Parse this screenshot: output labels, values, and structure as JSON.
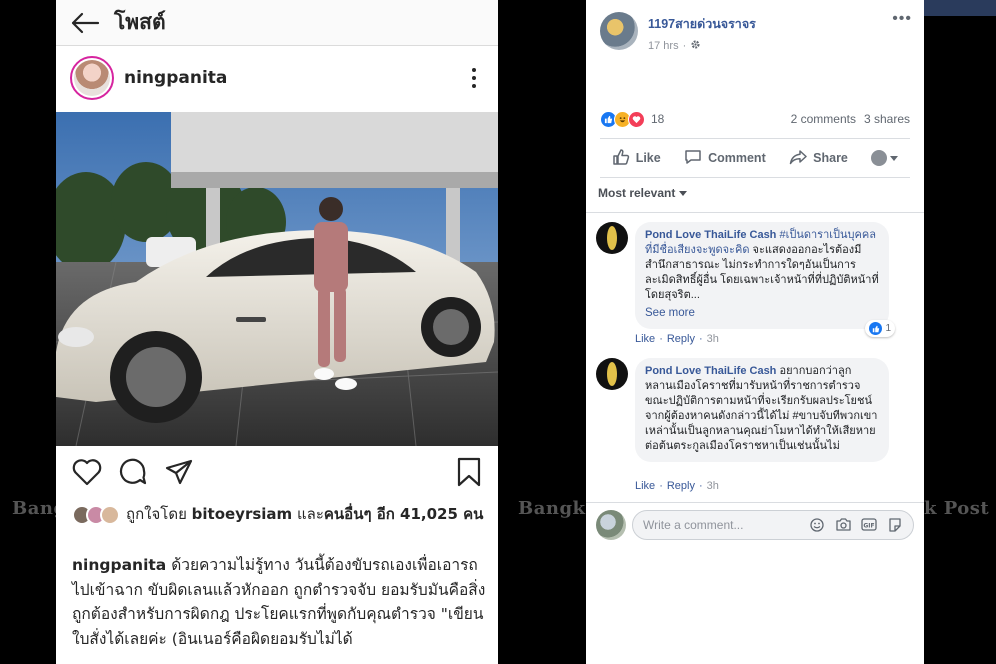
{
  "watermarks": {
    "left": "Bangk",
    "middle": "Bangko",
    "right": "k Post"
  },
  "instagram": {
    "header_title": "โพสต์",
    "username": "ningpanita",
    "liked_by_prefix": "ถูกใจโดย",
    "liked_by_user": "bitoeyrsiam",
    "liked_by_and": "และ",
    "liked_by_others": "คนอื่นๆ อีก 41,025 คน",
    "caption_user": "ningpanita",
    "caption_text": "ด้วยความไม่รู้ทาง วันนี้ต้องขับรถเองเพื่อเอารถไปเข้าฉาก ขับผิดเลนแล้วหักออก ถูกตำรวจจับ ยอมรับมันคือสิ่งถูกต้องสำหรับการผิดกฎ ประโยคแรกที่พูดกับคุณตำรวจ \"เขียนใบสั่งได้เลยค่ะ (อินเนอร์คือผิดยอมรับไม่ได้"
  },
  "facebook": {
    "page_name": "1197สายด่วนจราจร",
    "post_time": "17 hrs",
    "reaction_count": "18",
    "comments_count": "2 comments",
    "shares_count": "3 shares",
    "actions": {
      "like": "Like",
      "comment": "Comment",
      "share": "Share"
    },
    "sort_label": "Most relevant",
    "comments": [
      {
        "author": "Pond Love ThaiLife Cash",
        "tag": "#เป็นดาราเป็นบุคคลที่มีชื่อเสียงจะพูดจะคิด",
        "text": "จะแสดงออกอะไรต้องมีสำนึกสาธารณะ ไม่กระทำการใดๆอันเป็นการละเมิดสิทธิ์ผู้อื่น โดยเฉพาะเจ้าหน้าที่ที่ปฏิบัติหน้าที่โดยสุจริต...",
        "see_more": "See more",
        "reactions": "1",
        "like": "Like",
        "reply": "Reply",
        "time": "3h"
      },
      {
        "author": "Pond Love ThaiLife Cash",
        "text": "อยากบอกว่าลูกหลานเมืองโคราชที่มารับหน้าที่ราชการตำรวจ ขณะปฏิบัติการตามหน้าที่จะเรียกรับผลประโยชน์จากผู้ต้องหาคนดังกล่าวนี้ได้ไม่ #ขาบจับทีพวกเขาเหล่านั้นเป็นลูกหลานคุณย่าโมหาได้ทำให้เสียหายต่อต้นตระกูลเมืองโคราชหาเป็นเช่นนั้นไม่",
        "like": "Like",
        "reply": "Reply",
        "time": "3h"
      }
    ],
    "write_placeholder": "Write a comment..."
  }
}
